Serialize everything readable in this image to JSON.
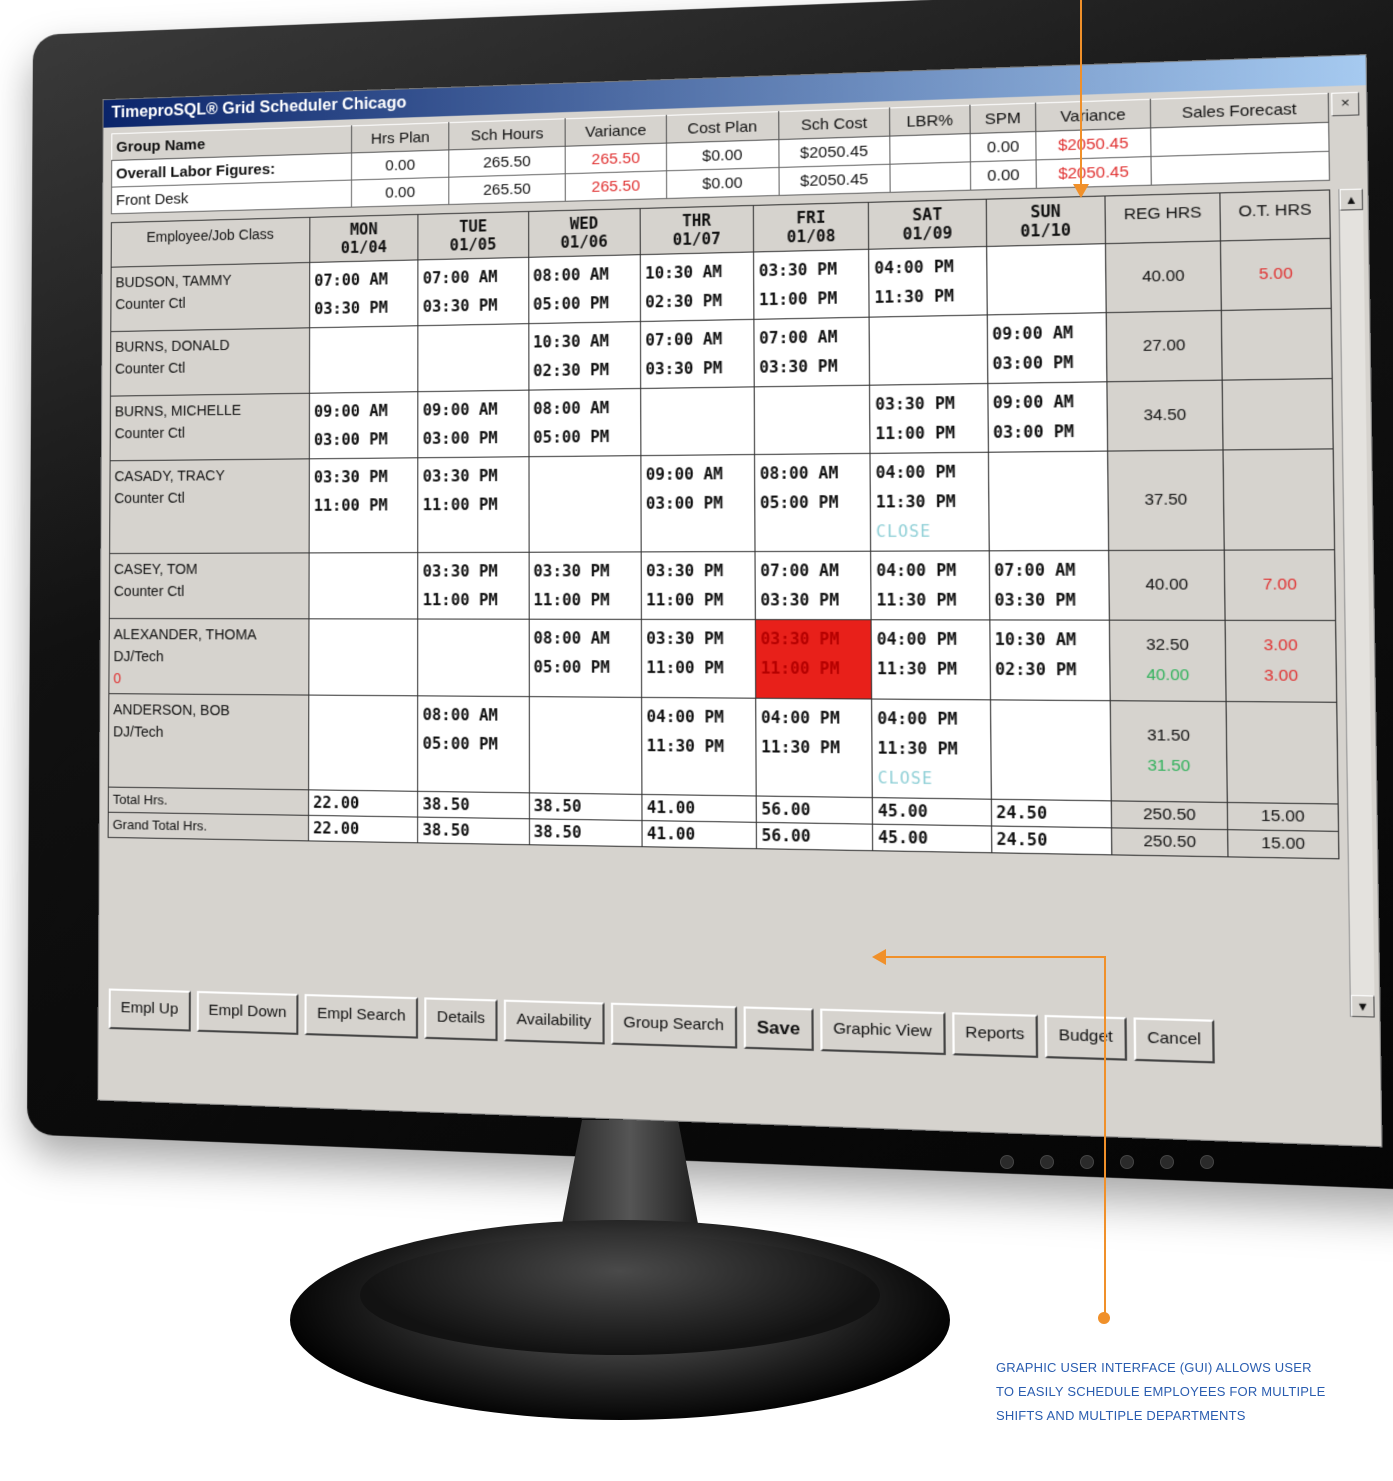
{
  "window": {
    "title": "TimeproSQL® Grid Scheduler Chicago"
  },
  "summary": {
    "headers": [
      "Group Name",
      "Hrs Plan",
      "Sch Hours",
      "Variance",
      "Cost Plan",
      "Sch Cost",
      "LBR%",
      "SPM",
      "Variance",
      "Sales Forecast"
    ],
    "rows": [
      {
        "label": "Overall Labor Figures:",
        "hrs_plan": "0.00",
        "sch_hours": "265.50",
        "variance": "265.50",
        "cost_plan": "$0.00",
        "sch_cost": "$2050.45",
        "lbr": "",
        "spm": "0.00",
        "variance2": "$2050.45",
        "forecast": ""
      },
      {
        "label": "Front Desk",
        "hrs_plan": "0.00",
        "sch_hours": "265.50",
        "variance": "265.50",
        "cost_plan": "$0.00",
        "sch_cost": "$2050.45",
        "lbr": "",
        "spm": "0.00",
        "variance2": "$2050.45",
        "forecast": ""
      }
    ]
  },
  "grid": {
    "emp_header": "Employee/Job Class",
    "days": [
      {
        "name": "MON",
        "date": "01/04"
      },
      {
        "name": "TUE",
        "date": "01/05"
      },
      {
        "name": "WED",
        "date": "01/06"
      },
      {
        "name": "THR",
        "date": "01/07"
      },
      {
        "name": "FRI",
        "date": "01/08"
      },
      {
        "name": "SAT",
        "date": "01/09"
      },
      {
        "name": "SUN",
        "date": "01/10"
      }
    ],
    "reg_header": "REG HRS",
    "ot_header": "O.T. HRS",
    "employees": [
      {
        "name": "BUDSON, TAMMY",
        "job": "Counter Ctl",
        "shifts": [
          "07:00 AM\n03:30 PM",
          "07:00 AM\n03:30 PM",
          "08:00 AM\n05:00 PM",
          "10:30 AM\n02:30 PM",
          "03:30 PM\n11:00 PM",
          "04:00 PM\n11:30 PM",
          ""
        ],
        "reg": "40.00",
        "ot": "5.00"
      },
      {
        "name": "BURNS, DONALD",
        "job": "Counter Ctl",
        "shifts": [
          "",
          "",
          "10:30 AM\n02:30 PM",
          "07:00 AM\n03:30 PM",
          "07:00 AM\n03:30 PM",
          "",
          "09:00 AM\n03:00 PM"
        ],
        "reg": "27.00",
        "ot": ""
      },
      {
        "name": "BURNS, MICHELLE",
        "job": "Counter Ctl",
        "shifts": [
          "09:00 AM\n03:00 PM",
          "09:00 AM\n03:00 PM",
          "08:00 AM\n05:00 PM",
          "",
          "",
          "03:30 PM\n11:00 PM",
          "09:00 AM\n03:00 PM"
        ],
        "reg": "34.50",
        "ot": ""
      },
      {
        "name": "CASADY, TRACY",
        "job": "Counter Ctl",
        "shifts": [
          "03:30 PM\n11:00 PM",
          "03:30 PM\n11:00 PM",
          "",
          "09:00 AM\n03:00 PM",
          "08:00 AM\n05:00 PM",
          "04:00 PM\n11:30 PM\nCLOSE",
          ""
        ],
        "reg": "37.50",
        "ot": ""
      },
      {
        "name": "CASEY, TOM",
        "job": "Counter Ctl",
        "shifts": [
          "",
          "03:30 PM\n11:00 PM",
          "03:30 PM\n11:00 PM",
          "03:30 PM\n11:00 PM",
          "07:00 AM\n03:30 PM",
          "04:00 PM\n11:30 PM",
          "07:00 AM\n03:30 PM"
        ],
        "reg": "40.00",
        "ot": "7.00"
      },
      {
        "name": "ALEXANDER, THOMA",
        "job": "DJ/Tech",
        "extra": "0",
        "shifts": [
          "",
          "",
          "08:00 AM\n05:00 PM",
          "03:30 PM\n11:00 PM",
          "03:30 PM\n11:00 PM",
          "04:00 PM\n11:30 PM",
          "10:30 AM\n02:30 PM"
        ],
        "reg": "32.50",
        "reg2": "40.00",
        "ot": "3.00",
        "ot2": "3.00"
      },
      {
        "name": "ANDERSON, BOB",
        "job": "DJ/Tech",
        "shifts": [
          "",
          "08:00 AM\n05:00 PM",
          "",
          "04:00 PM\n11:30 PM",
          "04:00 PM\n11:30 PM",
          "04:00 PM\n11:30 PM\nCLOSE",
          ""
        ],
        "reg": "31.50",
        "reg2": "31.50",
        "ot": ""
      }
    ],
    "totals": {
      "total_label": "Total Hrs.",
      "grand_label": "Grand Total Hrs.",
      "total": [
        "22.00",
        "38.50",
        "38.50",
        "41.00",
        "56.00",
        "45.00",
        "24.50",
        "250.50",
        "15.00"
      ],
      "grand": [
        "22.00",
        "38.50",
        "38.50",
        "41.00",
        "56.00",
        "45.00",
        "24.50",
        "250.50",
        "15.00"
      ]
    }
  },
  "buttons": [
    "Empl Up",
    "Empl Down",
    "Empl Search",
    "Details",
    "Availability",
    "Group Search",
    "Save",
    "Graphic View",
    "Reports",
    "Budget",
    "Cancel"
  ],
  "caption": "GRAPHIC USER INTERFACE (GUI) ALLOWS USER TO EASILY SCHEDULE EMPLOYEES FOR MULTIPLE SHIFTS AND MULTIPLE DEPARTMENTS",
  "colors": {
    "accent": "#f0902a",
    "red_cell": "#e8201a",
    "title_bar": "#0a246a",
    "caption": "#2a5db0"
  }
}
